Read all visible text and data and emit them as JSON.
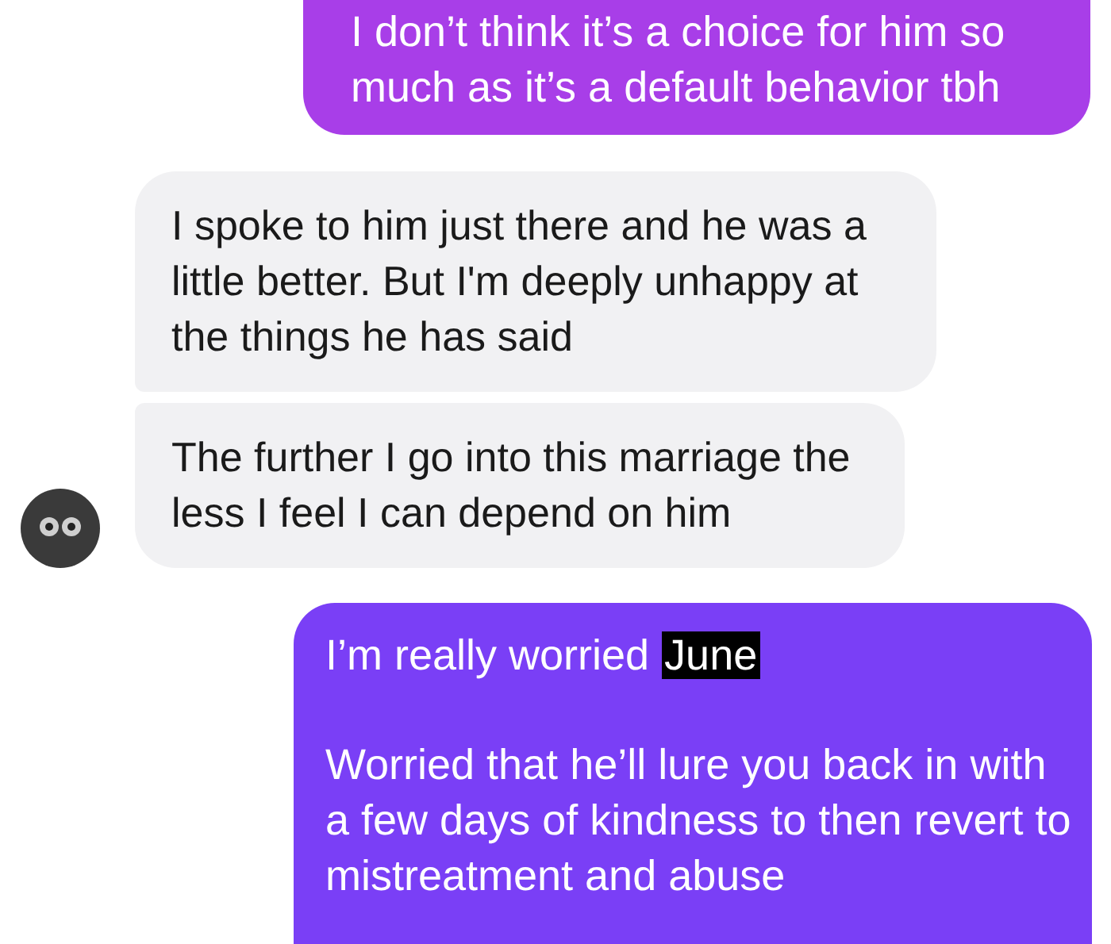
{
  "messages": [
    {
      "kind": "sent",
      "color": "#a83ee8",
      "paragraphs": [
        [
          {
            "text": "I don’t think it’s a choice for him so much as it’s a default behavior tbh",
            "highlighted": false
          }
        ]
      ]
    },
    {
      "kind": "received",
      "avatar": false,
      "paragraphs": [
        [
          {
            "text": "I spoke to him just there and he was a little better. But I'm deeply unhappy at the things he has said",
            "highlighted": false
          }
        ]
      ]
    },
    {
      "kind": "received",
      "avatar": true,
      "paragraphs": [
        [
          {
            "text": "The further I go into this marriage the less I feel I can depend on him",
            "highlighted": false
          }
        ]
      ]
    },
    {
      "kind": "sent",
      "color": "#7a3ff6",
      "paragraphs": [
        [
          {
            "text": "I’m really worried ",
            "highlighted": false
          },
          {
            "text": "June",
            "highlighted": true
          }
        ],
        [
          {
            "text": "Worried that he’ll lure you back in with a few days of kindness to then revert to mistreatment and abuse",
            "highlighted": false
          }
        ]
      ]
    }
  ]
}
